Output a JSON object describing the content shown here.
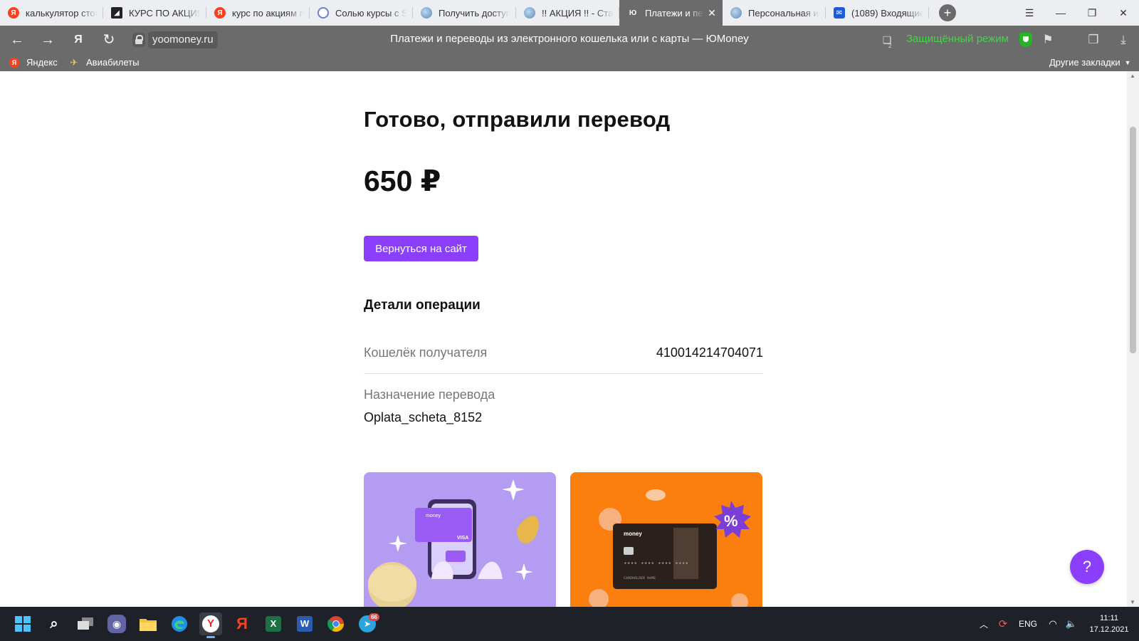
{
  "browser": {
    "tabs": [
      {
        "label": "калькулятор стоп",
        "icon": "yandex-icon"
      },
      {
        "label": "КУРС ПО АКЦИЯМ",
        "icon": "course-icon"
      },
      {
        "label": "курс по акциям п",
        "icon": "yandex-icon"
      },
      {
        "label": "Солью курсы с SI",
        "icon": "shield-icon"
      },
      {
        "label": "Получить доступ",
        "icon": "globe-icon"
      },
      {
        "label": "!! АКЦИЯ !! - Стат",
        "icon": "globe-icon"
      },
      {
        "label": "Платежи и пер",
        "icon": "yoomoney-icon",
        "active": true
      },
      {
        "label": "Персональная ин",
        "icon": "globe-icon"
      },
      {
        "label": "(1089) Входящие",
        "icon": "mail-icon"
      }
    ],
    "url": "yoomoney.ru",
    "page_title": "Платежи и переводы из электронного кошелька или с карты — ЮMoney",
    "protect_label": "Защищённый режим",
    "tabs_count": "2",
    "bookmarks": [
      {
        "label": "Яндекс"
      },
      {
        "label": "Авиабилеты"
      }
    ],
    "other_bookmarks": "Другие закладки"
  },
  "page": {
    "title": "Готово, отправили перевод",
    "amount": "650 ₽",
    "back_button": "Вернуться на сайт",
    "details_title": "Детали операции",
    "wallet_label": "Кошелёк получателя",
    "wallet_value": "4100142147040​71",
    "purpose_label": "Назначение перевода",
    "purpose_value": "Oplata_scheta_8152",
    "promo_left_card_brand": "money",
    "promo_left_card_visa": "VISA",
    "promo_right_card_brand": "money",
    "promo_right_card_number": "**** **** **** ****",
    "promo_right_card_holder": "CARDHOLDER NAME",
    "promo_right_badge": "%",
    "help_label": "?"
  },
  "taskbar": {
    "lang": "ENG",
    "time": "11:11",
    "date": "17.12.2021",
    "telegram_badge": "66"
  }
}
